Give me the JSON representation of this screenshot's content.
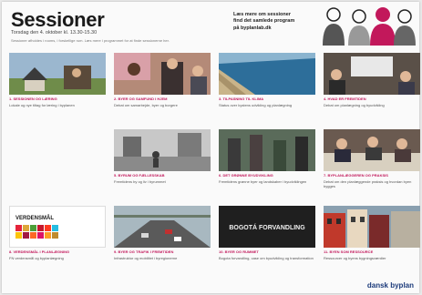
{
  "header": {
    "title": "Sessioner",
    "subtitle": "Torsdag den 4. oktober kl. 13.30-15.30",
    "intro": "Sessioner afholdes i rooms, i forskellige rum. Læs mere i programmet for at finde sessionerne her."
  },
  "promo": {
    "line1": "Læs mere om sessioner",
    "line2": "find det samlede program",
    "line3": "på byplanlab.dk"
  },
  "brand": {
    "logo": "dansk byplan"
  },
  "sessions": [
    {
      "title": "1. Sessionen og læring",
      "desc": "Lokale og nye tiltag for læring i byplanen"
    },
    {
      "title": "2. Byer og samfund i hjem",
      "desc": "Debat om samarbejde, byer og borgere"
    },
    {
      "title": "3. Tilpasning til klima",
      "desc": "Status over kystens udvikling og planlægning"
    },
    {
      "title": "4. Hvad er fremtiden",
      "desc": "Debat om planlægning og byudvikling"
    },
    {
      "title": "5. Byrum og fællesskab",
      "desc": "Fremtidens by og liv i byrummet"
    },
    {
      "title": "6. Det grønne byudvikling",
      "desc": "Fremtidens grønne byer og landskaber i byudviklingen"
    },
    {
      "title": "7. Byplanlæggeren og praksis",
      "desc": "Debat om den planlæggende praksis og hvordan byen bygges"
    },
    {
      "title": "8. Verdensmål i planlægning",
      "desc": "FN verdensmål og byplanlægning"
    },
    {
      "title": "9. Byer og trafik i fremtiden",
      "desc": "Infrastruktur og mobilitet i byregionerne"
    },
    {
      "title": "10. Byer og rummet",
      "desc": "Bogota forvandling, case om byudvikling og transformation"
    },
    {
      "title": "11. Byen som ressource",
      "desc": "Ressourcer og byens bygningsværdier"
    }
  ],
  "images": {
    "sdg_text": "VERDENSMÅL",
    "bogota_text": "BOGOTÁ FORVANDLING"
  },
  "colors": {
    "accent": "#c2185b",
    "brand": "#1b3a7a"
  }
}
